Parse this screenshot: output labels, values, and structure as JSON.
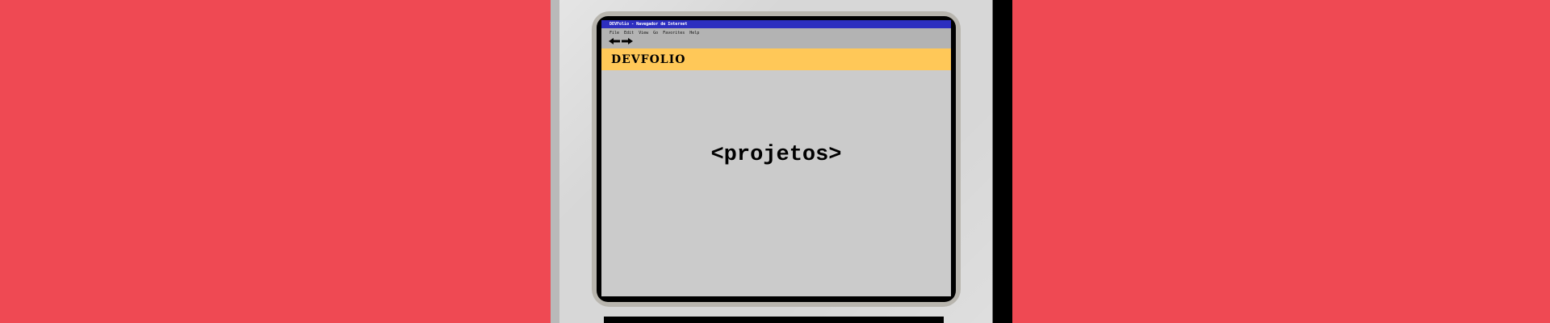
{
  "window": {
    "title": "DEVFolio - Navegador de Internet"
  },
  "menu": {
    "items": [
      "File",
      "Edit",
      "View",
      "Go",
      "Favorites",
      "Help"
    ]
  },
  "navigation": {
    "back_icon": "arrow-left-icon",
    "forward_icon": "arrow-right-icon"
  },
  "site": {
    "logo": "DEVFOLIO",
    "heading": "<projetos>"
  },
  "colors": {
    "background": "#ef4953",
    "bezel": "#d7d7d7",
    "titlebar": "#2d2fc0",
    "toolbar": "#b3b3b3",
    "header": "#ffc858",
    "screen": "#cbcbcb"
  }
}
